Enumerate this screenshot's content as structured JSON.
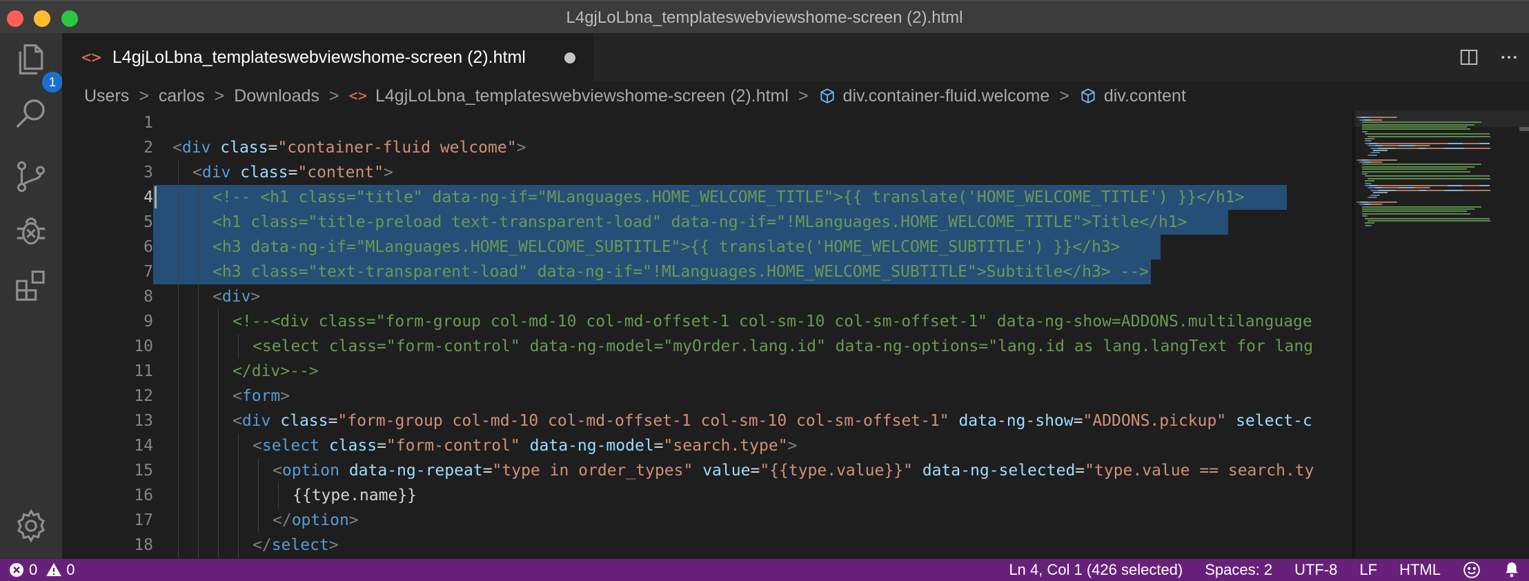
{
  "window": {
    "title": "L4gjLoLbna_templateswebviewshome-screen (2).html"
  },
  "activity_bar": {
    "items": [
      "explorer-icon",
      "search-icon",
      "source-control-icon",
      "debug-icon",
      "extensions-icon"
    ],
    "explorer_badge": "1",
    "bottom_item": "settings-gear-icon"
  },
  "tabs": [
    {
      "label": "L4gjLoLbna_templateswebviewshome-screen (2).html",
      "icon": "<>",
      "modified": true
    }
  ],
  "breadcrumb": {
    "items": [
      "Users",
      "carlos",
      "Downloads",
      "L4gjLoLbna_templateswebviewshome-screen (2).html",
      "div.container-fluid.welcome",
      "div.content"
    ],
    "separator": ">"
  },
  "editor": {
    "line_numbers": [
      "1",
      "2",
      "3",
      "4",
      "5",
      "6",
      "7",
      "8",
      "9",
      "10",
      "11",
      "12",
      "13",
      "14",
      "15",
      "16",
      "17",
      "18"
    ],
    "active_line": 4,
    "selected_lines": [
      4,
      5,
      6,
      7
    ],
    "lines": [
      [],
      [
        [
          "br",
          "<"
        ],
        [
          "tag",
          "div"
        ],
        [
          "txt",
          " "
        ],
        [
          "attr",
          "class"
        ],
        [
          "txt",
          "="
        ],
        [
          "str",
          "\"container-fluid welcome\""
        ],
        [
          "br",
          ">"
        ]
      ],
      [
        [
          "br",
          "<"
        ],
        [
          "tag",
          "div"
        ],
        [
          "txt",
          " "
        ],
        [
          "attr",
          "class"
        ],
        [
          "txt",
          "="
        ],
        [
          "str",
          "\"content\""
        ],
        [
          "br",
          ">"
        ]
      ],
      [
        [
          "cmt",
          "<!-- <h1 class=\"title\" data-ng-if=\"MLanguages.HOME_WELCOME_TITLE\">{{ translate('HOME_WELCOME_TITLE') }}</h1>"
        ]
      ],
      [
        [
          "cmt",
          "<h1 class=\"title-preload text-transparent-load\" data-ng-if=\"!MLanguages.HOME_WELCOME_TITLE\">Title</h1>"
        ]
      ],
      [
        [
          "cmt",
          "<h3 data-ng-if=\"MLanguages.HOME_WELCOME_SUBTITLE\">{{ translate('HOME_WELCOME_SUBTITLE') }}</h3>"
        ]
      ],
      [
        [
          "cmt",
          "<h3 class=\"text-transparent-load\" data-ng-if=\"!MLanguages.HOME_WELCOME_SUBTITLE\">Subtitle</h3> -->"
        ]
      ],
      [
        [
          "br",
          "<"
        ],
        [
          "tag",
          "div"
        ],
        [
          "br",
          ">"
        ]
      ],
      [
        [
          "cmt",
          "<!--<div class=\"form-group col-md-10 col-md-offset-1 col-sm-10 col-sm-offset-1\" data-ng-show=ADDONS.multilanguage"
        ]
      ],
      [
        [
          "cmt",
          "<select class=\"form-control\" data-ng-model=\"myOrder.lang.id\" data-ng-options=\"lang.id as lang.langText for lang"
        ]
      ],
      [
        [
          "cmt",
          "</div>-->"
        ]
      ],
      [
        [
          "br",
          "<"
        ],
        [
          "tag",
          "form"
        ],
        [
          "br",
          ">"
        ]
      ],
      [
        [
          "br",
          "<"
        ],
        [
          "tag",
          "div"
        ],
        [
          "txt",
          " "
        ],
        [
          "attr",
          "class"
        ],
        [
          "txt",
          "="
        ],
        [
          "str",
          "\"form-group col-md-10 col-md-offset-1 col-sm-10 col-sm-offset-1\""
        ],
        [
          "txt",
          " "
        ],
        [
          "attr",
          "data-ng-show"
        ],
        [
          "txt",
          "="
        ],
        [
          "str",
          "\"ADDONS.pickup\""
        ],
        [
          "txt",
          " "
        ],
        [
          "attr",
          "select-c"
        ]
      ],
      [
        [
          "br",
          "<"
        ],
        [
          "tag",
          "select"
        ],
        [
          "txt",
          " "
        ],
        [
          "attr",
          "class"
        ],
        [
          "txt",
          "="
        ],
        [
          "str",
          "\"form-control\""
        ],
        [
          "txt",
          " "
        ],
        [
          "attr",
          "data-ng-model"
        ],
        [
          "txt",
          "="
        ],
        [
          "str",
          "\"search.type\""
        ],
        [
          "br",
          ">"
        ]
      ],
      [
        [
          "br",
          "<"
        ],
        [
          "tag",
          "option"
        ],
        [
          "txt",
          " "
        ],
        [
          "attr",
          "data-ng-repeat"
        ],
        [
          "txt",
          "="
        ],
        [
          "str",
          "\"type in order_types\""
        ],
        [
          "txt",
          " "
        ],
        [
          "attr",
          "value"
        ],
        [
          "txt",
          "="
        ],
        [
          "str",
          "\"{{type.value}}\""
        ],
        [
          "txt",
          " "
        ],
        [
          "attr",
          "data-ng-selected"
        ],
        [
          "txt",
          "="
        ],
        [
          "str",
          "\"type.value == search.ty"
        ]
      ],
      [
        [
          "txt",
          "{{type.name}}"
        ]
      ],
      [
        [
          "br",
          "</"
        ],
        [
          "tag",
          "option"
        ],
        [
          "br",
          ">"
        ]
      ],
      [
        [
          "br",
          "</"
        ],
        [
          "tag",
          "select"
        ],
        [
          "br",
          ">"
        ]
      ]
    ]
  },
  "status_bar": {
    "errors": "0",
    "warnings": "0",
    "position": "Ln 4, Col 1 (426 selected)",
    "indent": "Spaces: 2",
    "encoding": "UTF-8",
    "eol": "LF",
    "language": "HTML",
    "feedback_icon": "smiley-icon",
    "notifications_icon": "bell-icon"
  },
  "colors": {
    "statusbar": "#68217a",
    "selection": "#264f78",
    "comment": "#6a9955",
    "tag": "#569cd6",
    "attribute": "#9cdcfe",
    "string": "#ce9178",
    "badge": "#1c6fd1"
  }
}
